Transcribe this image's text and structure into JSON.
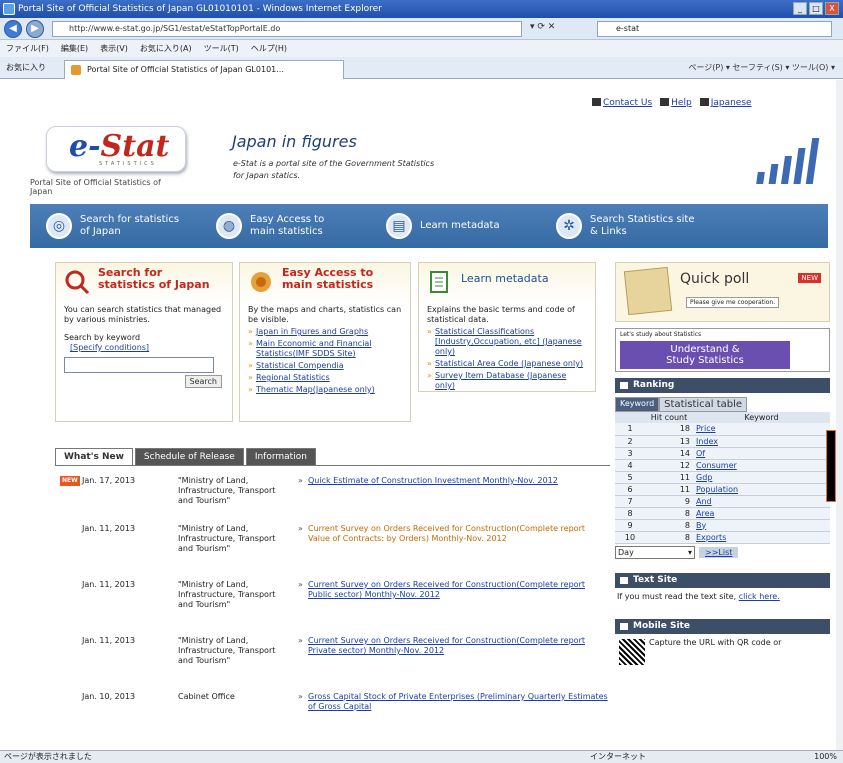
{
  "window": {
    "title": "Portal Site of Official Statistics of Japan GL01010101 - Windows Internet Explorer",
    "url": "http://www.e-stat.go.jp/SG1/estat/eStatTopPortalE.do",
    "search_value": "e-stat",
    "min": "_",
    "max": "□",
    "close": "X"
  },
  "browser": {
    "menu": [
      "ファイル(F)",
      "編集(E)",
      "表示(V)",
      "お気に入り(A)",
      "ツール(T)",
      "ヘルプ(H)"
    ],
    "favorites_label": "お気に入り",
    "tab_title": "Portal Site of Official Statistics of Japan GL0101...",
    "commands": "ページ(P) ▾  セーフティ(S) ▾  ツール(O) ▾",
    "status_left": "ページが表示されました",
    "status_mid": "インターネット",
    "status_zoom": "100%"
  },
  "toplinks": {
    "contact": "Contact Us",
    "help": "Help",
    "japanese": "Japanese"
  },
  "header": {
    "logo_e": "e-",
    "logo_stat": "Stat",
    "logo_sub": "STATISTICS",
    "portal": "Portal Site of Official Statistics of Japan",
    "tagline": "Japan in figures",
    "desc1": "e-Stat is a portal site of the Government Statistics",
    "desc2": "for Japan statics."
  },
  "nav": [
    "Search for statistics of Japan",
    "Easy Access to main statistics",
    "Learn metadata",
    "Search Statistics site & Links"
  ],
  "search_box": {
    "title1": "Search for",
    "title2": "statistics of Japan",
    "desc": "You can search statistics that managed by various ministries.",
    "keyword_label": "Search by keyword",
    "specify": "[Specify conditions]",
    "input_value": "",
    "button": "Search"
  },
  "easy_box": {
    "title1": "Easy Access to",
    "title2": "main statistics",
    "desc": "By the maps and charts, statistics can be visible.",
    "links": [
      "Japan in Figures and Graphs",
      "Main Economic and Financial Statistics(IMF SDDS Site)",
      "Statistical Compendia",
      "Regional Statistics",
      "Thematic Map(Japanese only)"
    ]
  },
  "learn_box": {
    "title": "Learn metadata",
    "desc": "Explains the basic terms and code of statistical data.",
    "links": [
      "Statistical Classifications [Industry,Occupation, etc] (Japanese only)",
      "Statistical Area Code (Japanese only)",
      "Survey Item Database (Japanese only)"
    ]
  },
  "poll": {
    "title": "Quick poll",
    "badge": "NEW",
    "sub": "Please give me cooperation."
  },
  "study": {
    "top": "Let's study about Statistics",
    "line1": "Understand &",
    "line2": "Study Statistics"
  },
  "ranking": {
    "title": "Ranking",
    "tab_keyword": "Keyword",
    "tab_table": "Statistical table",
    "col_hits": "Hit count",
    "col_keyword": "Keyword",
    "rows": [
      [
        "1",
        "18",
        "Price"
      ],
      [
        "2",
        "13",
        "Index"
      ],
      [
        "3",
        "14",
        "Of"
      ],
      [
        "4",
        "12",
        "Consumer"
      ],
      [
        "5",
        "11",
        "Gdp"
      ],
      [
        "6",
        "11",
        "Population"
      ],
      [
        "7",
        "9",
        "And"
      ],
      [
        "8",
        "8",
        "Area"
      ],
      [
        "9",
        "8",
        "By"
      ],
      [
        "10",
        "8",
        "Exports"
      ]
    ],
    "period": "Day",
    "more": ">>List"
  },
  "textsite": {
    "title": "Text Site",
    "text": "If you must read the text site,",
    "link": "click here."
  },
  "mobile": {
    "title": "Mobile Site",
    "text": "Capture the URL with QR code or"
  },
  "news": {
    "tabs": [
      "What's New",
      "Schedule of Release",
      "Information"
    ],
    "new_badge": "NEW",
    "items": [
      {
        "date": "Jan. 17, 2013",
        "org": "\"Ministry of Land, Infrastructure, Transport and Tourism\"",
        "title": "Quick Estimate of Construction Investment Monthly-Nov. 2012"
      },
      {
        "date": "Jan. 11, 2013",
        "org": "\"Ministry of Land, Infrastructure, Transport and Tourism\"",
        "title": "Current Survey on Orders Received for Construction(Complete report Value of Contracts: by Orders) Monthly-Nov. 2012"
      },
      {
        "date": "Jan. 11, 2013",
        "org": "\"Ministry of Land, Infrastructure, Transport and Tourism\"",
        "title": "Current Survey on Orders Received for Construction(Complete report Public sector) Monthly-Nov. 2012"
      },
      {
        "date": "Jan. 11, 2013",
        "org": "\"Ministry of Land, Infrastructure, Transport and Tourism\"",
        "title": "Current Survey on Orders Received for Construction(Complete report Private sector) Monthly-Nov. 2012"
      },
      {
        "date": "Jan. 10, 2013",
        "org": "Cabinet Office",
        "title": "Gross Capital Stock of Private Enterprises (Preliminary Quarterly Estimates of Gross Capital"
      }
    ]
  }
}
